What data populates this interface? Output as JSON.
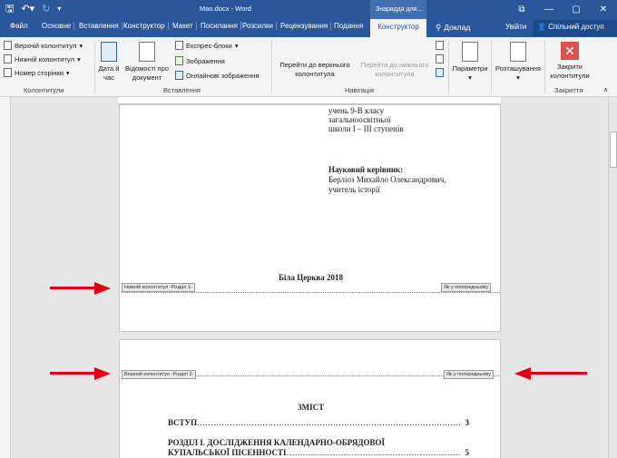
{
  "window": {
    "title": "Man.docx - Word",
    "context_tools": "Знаряддя для...",
    "controls": [
      "—",
      "▢",
      "✕",
      "⧉"
    ]
  },
  "tabs": [
    {
      "label": "Файл"
    },
    {
      "label": "Основне"
    },
    {
      "label": "Вставлення"
    },
    {
      "label": "Конструктор"
    },
    {
      "label": "Макет"
    },
    {
      "label": "Посилання"
    },
    {
      "label": "Розсилки"
    },
    {
      "label": "Рецензування"
    },
    {
      "label": "Подання"
    }
  ],
  "active_tab": "Конструктор",
  "tell_me": "Доклад",
  "sign_in": "Увійти",
  "share": "Спільний доступ",
  "ribbon": {
    "headers_footers": {
      "header": "Верхній колонтитул",
      "footer": "Нижній колонтитул",
      "page_number": "Номер сторінки",
      "label": "Колонтитули"
    },
    "insert": {
      "date_time": "Дата й час",
      "doc_info": "Відомості про документ",
      "quick_parts": "Експрес-блоки",
      "pictures": "Зображення",
      "online_pictures": "Онлайнові зображення",
      "label": "Вставлення"
    },
    "navigation": {
      "go_header": "Перейти до верхнього колонтитула",
      "go_footer": "Перейти до нижнього колонтитула",
      "label": "Навігація"
    },
    "options": "Параметри",
    "position": "Розташування",
    "close": {
      "button": "Закрити колонтитули",
      "label": "Закриття"
    }
  },
  "page1": {
    "student_lines": [
      "учень 9-В класу",
      "загальноосвітньої",
      "школи І – ІІІ ступенів"
    ],
    "supervisor_heading": "Науковий керівник:",
    "supervisor_lines": [
      "Берліоз Михайло Олександрович,",
      "учитель історії"
    ],
    "city_year": "Біла Церква 2018",
    "footer_tag": "Нижній колонтитул -Розділ 1-",
    "same_as_previous": "Як у попередньому"
  },
  "page2": {
    "header_tag": "Верхній колонтитул -Розділ 2-",
    "same_as_previous": "Як у попередньому",
    "toc_title": "ЗМІСТ",
    "toc": [
      {
        "text": "ВСТУП",
        "page": "3"
      },
      {
        "text": "РОЗДІЛ І.  ДОСЛІДЖЕННЯ  КАЛЕНДАРНО-ОБРЯДОВОЇ",
        "page": ""
      },
      {
        "text": "КУПАЛЬСЬКОЇ ПІСЕННОСТІ",
        "page": "5"
      }
    ]
  },
  "colors": {
    "word_blue": "#2b579a",
    "arrow_red": "#e3001b"
  }
}
